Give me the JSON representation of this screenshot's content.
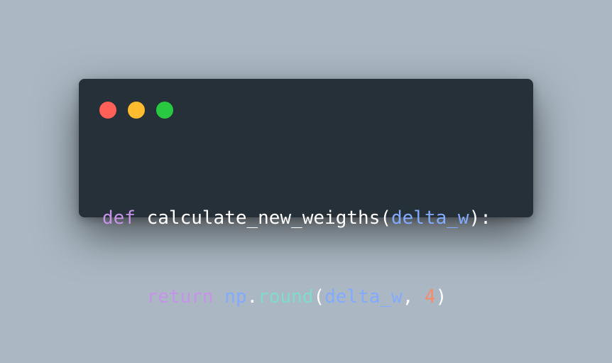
{
  "colors": {
    "background": "#abb8c3",
    "window": "#263038",
    "dot_close": "#ff5f56",
    "dot_minimize": "#ffbd2e",
    "dot_zoom": "#27c93f",
    "keyword": "#c792ea",
    "function_name": "#ffffff",
    "param": "#82aaff",
    "module": "#82aaff",
    "method": "#89ddff",
    "punctuation": "#ffffff",
    "number": "#f78c6c"
  },
  "code": {
    "line1": {
      "kw_def": "def",
      "fn_name": "calculate_new_weigths",
      "paren_open": "(",
      "param": "delta_w",
      "paren_close_colon": "):"
    },
    "line2": {
      "indent": "    ",
      "kw_return": "return",
      "module": "np",
      "dot": ".",
      "method": "round",
      "paren_open": "(",
      "arg": "delta_w",
      "comma": ",",
      "number": "4",
      "paren_close": ")"
    }
  }
}
